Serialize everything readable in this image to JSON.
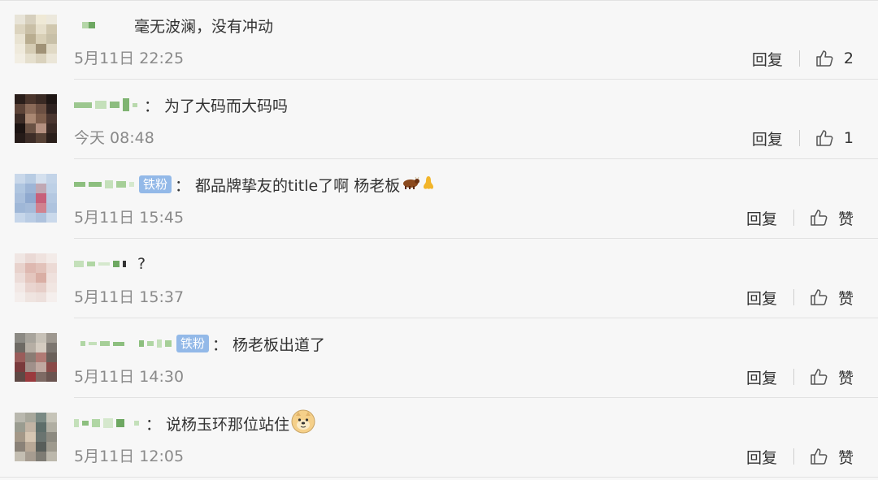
{
  "reply_label": "回复",
  "zan_label": "赞",
  "badge_label": "铁粉",
  "colon": "：",
  "comments": [
    {
      "text": "毫无波澜，没有冲动",
      "time": "5月11日 22:25",
      "likes": "2",
      "badge": false,
      "emoji": null
    },
    {
      "text": "为了大码而大码吗",
      "time": "今天 08:48",
      "likes": "1",
      "badge": false,
      "emoji": null
    },
    {
      "text": "都品牌挚友的title了啊 杨老板",
      "time": "5月11日 15:45",
      "likes": "赞",
      "badge": true,
      "emoji": "cow-and-nose"
    },
    {
      "text": "?",
      "time": "5月11日 15:37",
      "likes": "赞",
      "badge": false,
      "emoji": null
    },
    {
      "text": "杨老板出道了",
      "time": "5月11日 14:30",
      "likes": "赞",
      "badge": true,
      "emoji": null
    },
    {
      "text": "说杨玉环那位站住",
      "time": "5月11日 12:05",
      "likes": "赞",
      "badge": false,
      "emoji": "doge-face"
    }
  ]
}
